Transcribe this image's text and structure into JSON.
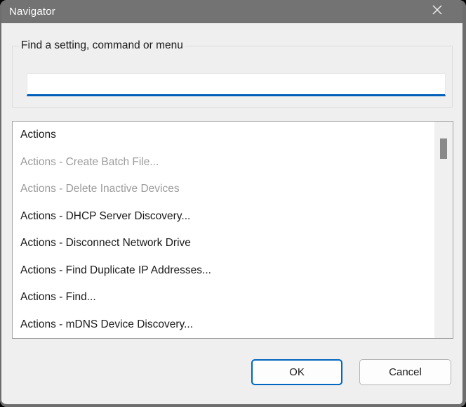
{
  "window": {
    "title": "Navigator",
    "close_icon": "x-close"
  },
  "search_group": {
    "label": "Find a setting, command or menu",
    "input_value": "",
    "input_placeholder": ""
  },
  "list": {
    "items": [
      {
        "label": "Actions",
        "enabled": true
      },
      {
        "label": "Actions - Create Batch File...",
        "enabled": false
      },
      {
        "label": "Actions - Delete Inactive Devices",
        "enabled": false
      },
      {
        "label": "Actions - DHCP Server Discovery...",
        "enabled": true
      },
      {
        "label": "Actions - Disconnect Network Drive",
        "enabled": true
      },
      {
        "label": "Actions - Find Duplicate IP Addresses...",
        "enabled": true
      },
      {
        "label": "Actions - Find...",
        "enabled": true
      },
      {
        "label": "Actions - mDNS Device Discovery...",
        "enabled": true
      }
    ]
  },
  "buttons": {
    "ok_label": "OK",
    "cancel_label": "Cancel"
  },
  "colors": {
    "titlebar": "#737373",
    "dialog_bg": "#efefef",
    "accent_underline": "#005fb8",
    "ok_border": "#0067c0",
    "disabled_text": "#9b9b9b",
    "enabled_text": "#1a1a1a",
    "scroll_thumb": "#8a8a8a"
  }
}
